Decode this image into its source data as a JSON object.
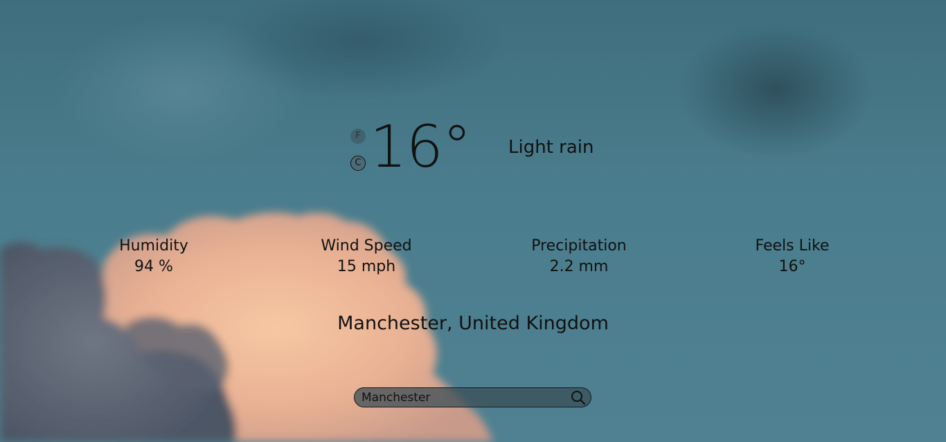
{
  "weather": {
    "temperature": "16°",
    "unit_f": "F",
    "unit_c": "C",
    "condition": "Light rain"
  },
  "stats": [
    {
      "label": "Humidity",
      "value": "94 %"
    },
    {
      "label": "Wind Speed",
      "value": "15 mph"
    },
    {
      "label": "Precipitation",
      "value": "2.2 mm"
    },
    {
      "label": "Feels Like",
      "value": "16°"
    }
  ],
  "location": "Manchester, United Kingdom",
  "search": {
    "value": "Manchester",
    "icon": "search-icon"
  },
  "colors": {
    "sky": "#4a7d8d",
    "cloud_highlight": "#f3c2a0",
    "text": "#111111"
  }
}
